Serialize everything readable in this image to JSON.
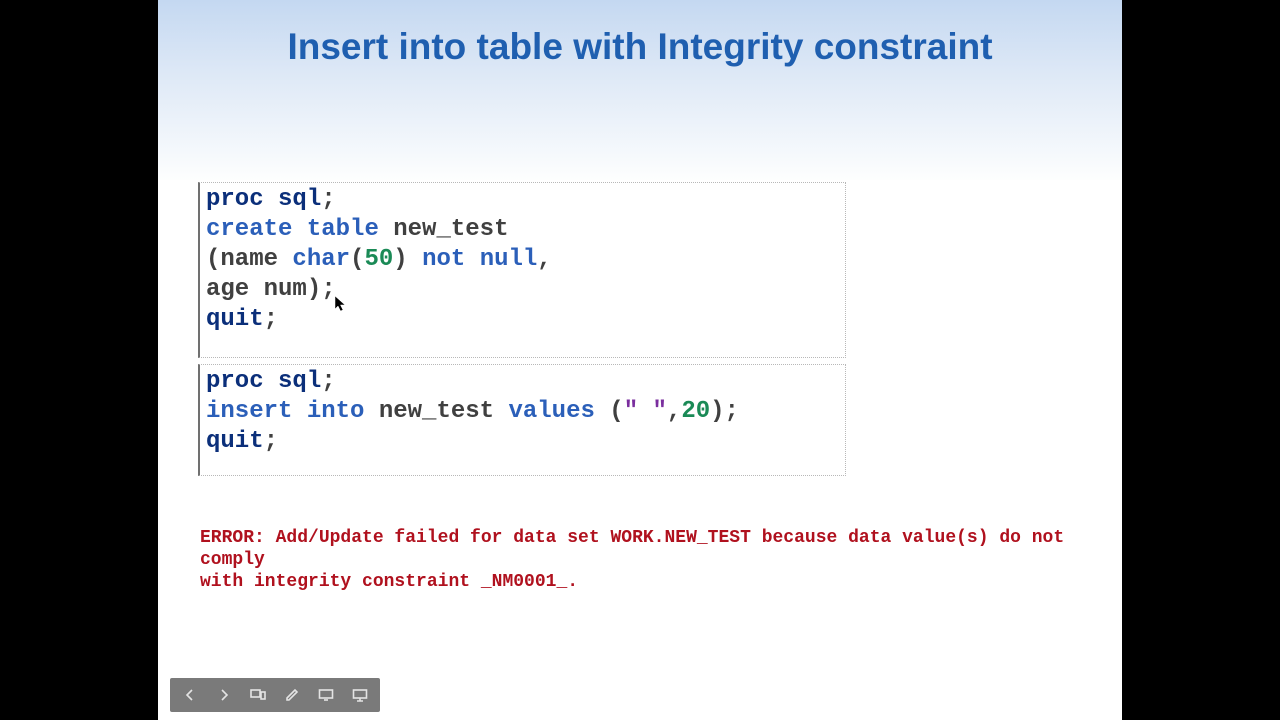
{
  "title": "Insert into table with Integrity constraint",
  "code1": {
    "l1": {
      "a": "proc sql",
      "b": ";"
    },
    "l2": {
      "a": "create",
      "b": " ",
      "c": "table",
      "d": " new_test"
    },
    "l3": {
      "a": "(name ",
      "b": "char",
      "c": "(",
      "d": "50",
      "e": ") ",
      "f": "not",
      "g": " ",
      "h": "null",
      "i": ","
    },
    "l4": {
      "a": "age num);"
    },
    "l5": {
      "a": "quit",
      "b": ";"
    }
  },
  "code2": {
    "l1": {
      "a": "proc sql",
      "b": ";"
    },
    "l2": {
      "a": "insert",
      "b": " ",
      "c": "into",
      "d": " new_test ",
      "e": "values",
      "f": " (",
      "g": "\" \"",
      "h": ",",
      "i": "20",
      "j": ");"
    },
    "l3": {
      "a": "quit",
      "b": ";"
    }
  },
  "error": {
    "l1": "ERROR: Add/Update failed for data set WORK.NEW_TEST because data value(s) do not comply",
    "l2": "with integrity constraint _NM0001_."
  },
  "toolbar": {
    "prev": "previous-slide",
    "next": "next-slide",
    "allslides": "slide-sorter",
    "pen": "pen-tool",
    "screen": "screen-options",
    "present": "presenter-view"
  }
}
